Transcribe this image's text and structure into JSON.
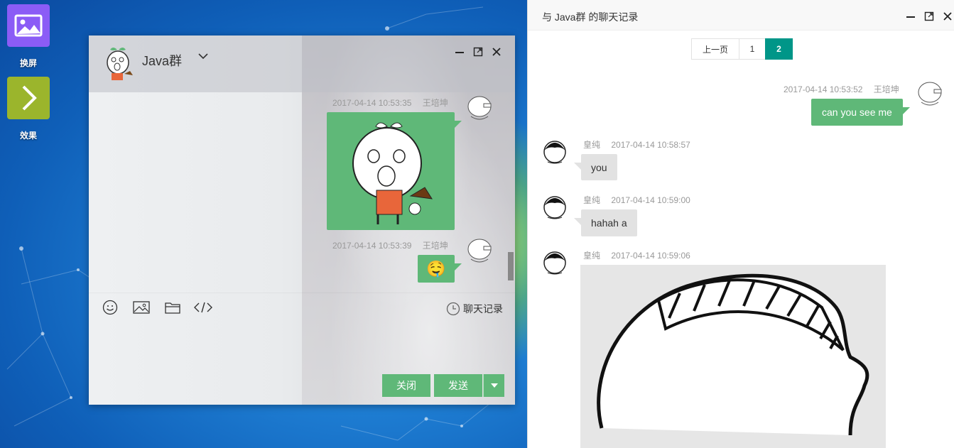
{
  "desktop": {
    "icons": [
      {
        "label": "换屏",
        "icon": "picture-icon",
        "color": "#8b5cf6"
      },
      {
        "label": "效果",
        "icon": "chevron-right-icon",
        "color": "#9bb52c"
      }
    ]
  },
  "chat": {
    "title": "Java群",
    "messages": [
      {
        "time": "2017-04-14 10:53:35",
        "user": "王培坤",
        "type": "image"
      },
      {
        "time": "2017-04-14 10:53:39",
        "user": "王培坤",
        "type": "emoji",
        "emoji": "🤤"
      }
    ],
    "toolbar": {
      "emoji": "smile-icon",
      "image": "image-icon",
      "file": "folder-icon",
      "code": "code-icon"
    },
    "history_label": "聊天记录",
    "close_label": "关闭",
    "send_label": "发送"
  },
  "history": {
    "title": "与 Java群 的聊天记录",
    "pager": {
      "prev": "上一页",
      "pages": [
        "1",
        "2"
      ],
      "active": "2"
    },
    "messages": [
      {
        "time": "2017-04-14 10:53:52",
        "user": "王培坤",
        "text": "can you see me",
        "side": "right"
      },
      {
        "user": "皇纯",
        "time": "2017-04-14 10:58:57",
        "text": "you",
        "side": "left"
      },
      {
        "user": "皇纯",
        "time": "2017-04-14 10:59:00",
        "text": "hahah a",
        "side": "left"
      },
      {
        "user": "皇纯",
        "time": "2017-04-14 10:59:06",
        "type": "image",
        "side": "left"
      }
    ]
  },
  "colors": {
    "accent": "#5fb878",
    "pager_active": "#009688"
  }
}
